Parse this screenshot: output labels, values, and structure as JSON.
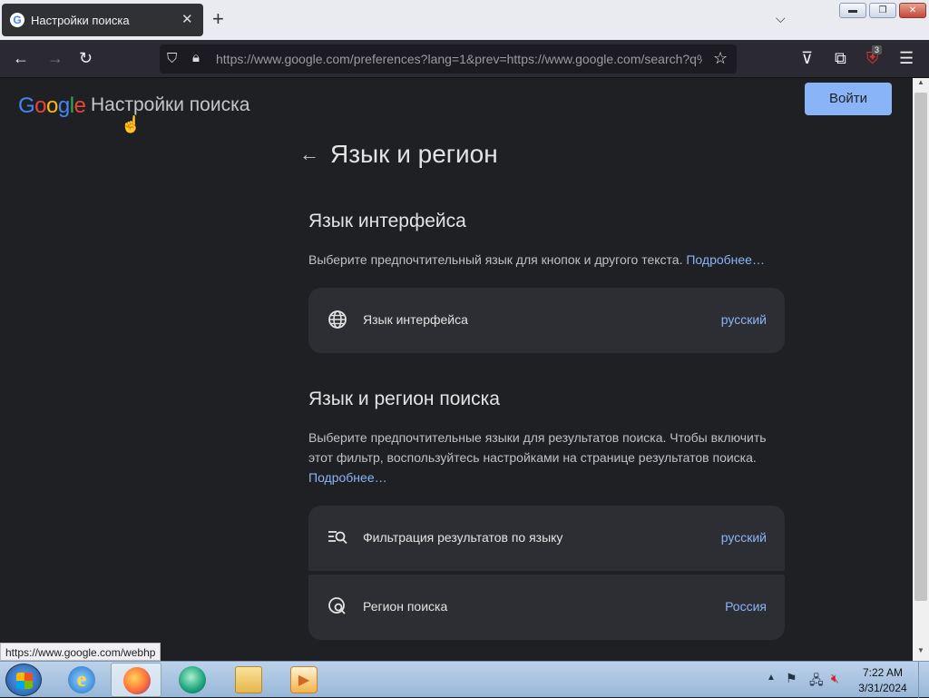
{
  "browser": {
    "tab_title": "Настройки поиска",
    "tab_favicon": "G",
    "new_tab_symbol": "+",
    "url": "https://www.google.com/preferences?lang=1&prev=https://www.google.com/search?q%",
    "extension_badge": "3",
    "status_url": "https://www.google.com/webhp"
  },
  "header": {
    "logo_letters": [
      {
        "ch": "G",
        "color": "#4285f4"
      },
      {
        "ch": "o",
        "color": "#ea4335"
      },
      {
        "ch": "o",
        "color": "#fbbc05"
      },
      {
        "ch": "g",
        "color": "#4285f4"
      },
      {
        "ch": "l",
        "color": "#34a853"
      },
      {
        "ch": "e",
        "color": "#ea4335"
      }
    ],
    "title": "Настройки поиска",
    "signin_label": "Войти"
  },
  "main": {
    "section_title": "Язык и регион",
    "interface": {
      "heading": "Язык интерфейса",
      "description": "Выберите предпочтительный язык для кнопок и другого текста.",
      "more_link": "Подробнее…",
      "card": {
        "icon": "globe-icon",
        "label": "Язык интерфейса",
        "value": "русский"
      }
    },
    "search_lang": {
      "heading": "Язык и регион поиска",
      "description": "Выберите предпочтительные языки для результатов поиска. Чтобы включить этот фильтр, воспользуйтесь настройками на странице результатов поиска.",
      "more_link": "Подробнее…",
      "filter_card": {
        "icon": "filter-search-icon",
        "label": "Фильтрация результатов по языку",
        "value": "русский"
      },
      "region_card": {
        "icon": "region-search-icon",
        "label": "Регион поиска",
        "value": "Россия"
      }
    }
  },
  "taskbar": {
    "time": "7:22 AM",
    "date": "3/31/2024"
  },
  "colors": {
    "page_bg": "#1f2023",
    "card_bg": "#2d2e33",
    "accent": "#8ab4f8"
  }
}
